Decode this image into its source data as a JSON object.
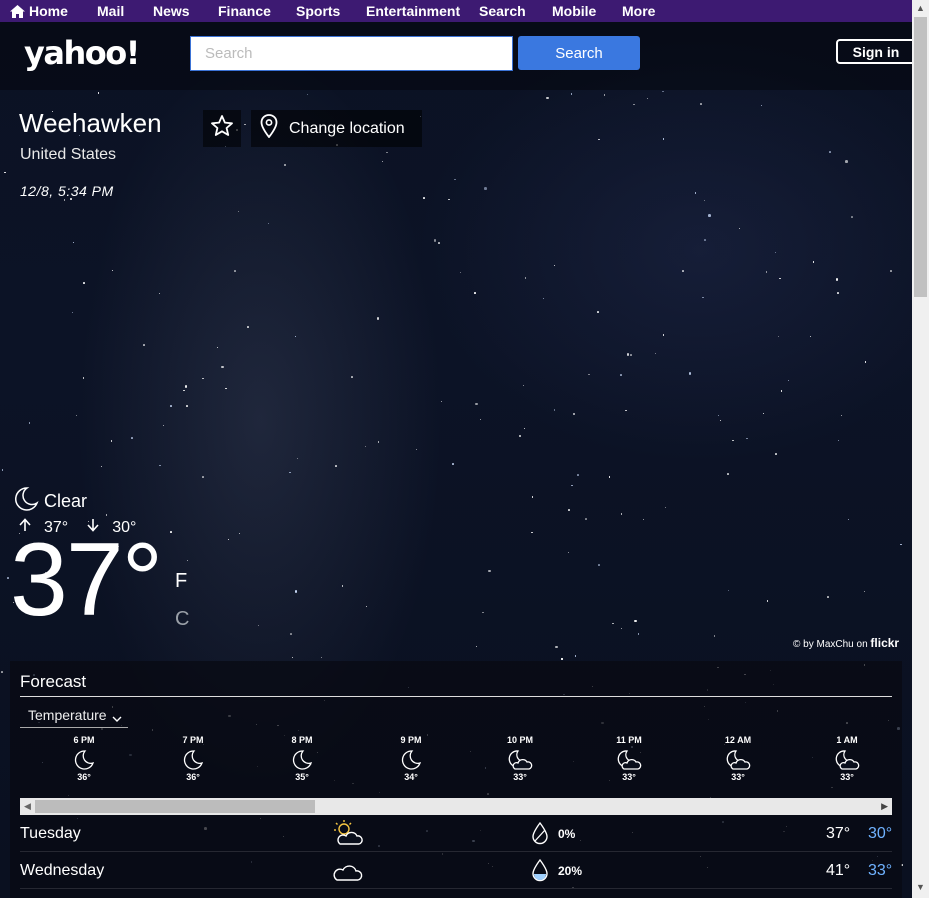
{
  "nav": {
    "items": [
      "Home",
      "Mail",
      "News",
      "Finance",
      "Sports",
      "Entertainment",
      "Search",
      "Mobile",
      "More"
    ]
  },
  "header": {
    "logo": "yahoo!",
    "search_placeholder": "Search",
    "search_button": "Search",
    "signin": "Sign in"
  },
  "location": {
    "city": "Weehawken",
    "country": "United States",
    "datetime": "12/8, 5:34 PM",
    "change_location": "Change location"
  },
  "current": {
    "condition": "Clear",
    "high": "37°",
    "low": "30°",
    "temp": "37°",
    "unit_f": "F",
    "unit_c": "C"
  },
  "credit": {
    "text": "© by MaxChu on",
    "brand": "flickr"
  },
  "forecast": {
    "title": "Forecast",
    "dropdown": "Temperature",
    "hourly": [
      {
        "time": "6 PM",
        "icon": "moon-icon",
        "temp": "36°"
      },
      {
        "time": "7 PM",
        "icon": "moon-icon",
        "temp": "36°"
      },
      {
        "time": "8 PM",
        "icon": "moon-icon",
        "temp": "35°"
      },
      {
        "time": "9 PM",
        "icon": "moon-icon",
        "temp": "34°"
      },
      {
        "time": "10 PM",
        "icon": "moon-cloud-icon",
        "temp": "33°"
      },
      {
        "time": "11 PM",
        "icon": "moon-cloud-icon",
        "temp": "33°"
      },
      {
        "time": "12 AM",
        "icon": "moon-cloud-icon",
        "temp": "33°"
      },
      {
        "time": "1 AM",
        "icon": "moon-cloud-icon",
        "temp": "33°"
      }
    ],
    "daily": [
      {
        "day": "Tuesday",
        "icon": "sun-cloud-icon",
        "precip": "0%",
        "high": "37°",
        "low": "30°"
      },
      {
        "day": "Wednesday",
        "icon": "cloud-icon",
        "precip": "20%",
        "high": "41°",
        "low": "33°"
      }
    ]
  },
  "colors": {
    "nav_bg": "#3d1a72",
    "search_button": "#3a78e0",
    "low_temp": "#6fb2ff"
  }
}
